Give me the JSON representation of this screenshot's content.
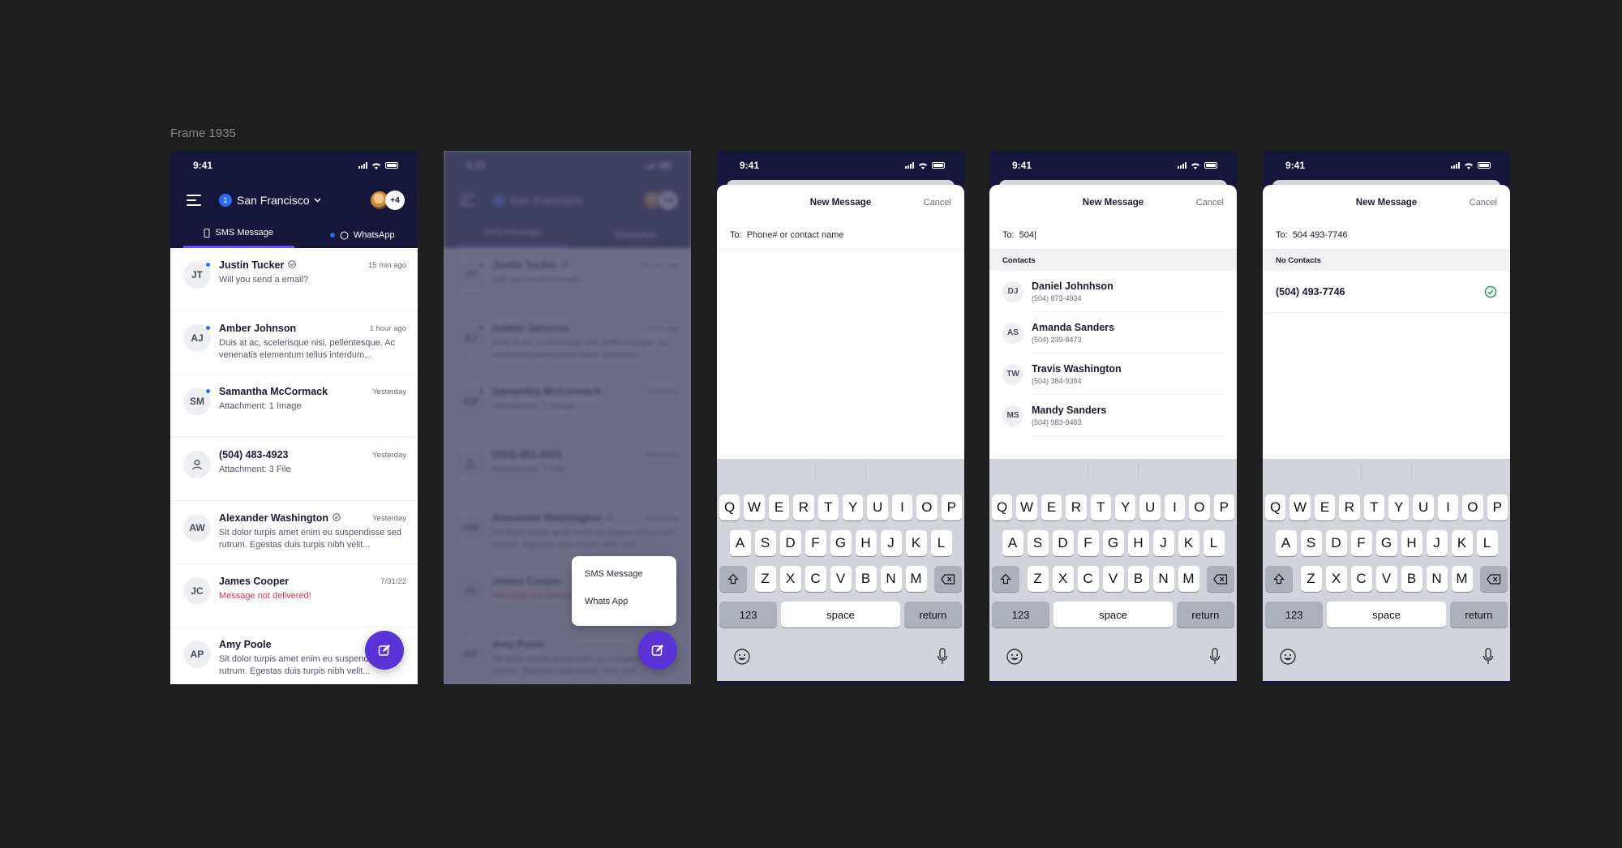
{
  "frame_title": "Frame 1935",
  "status_time": "9:41",
  "colors": {
    "header": "#16163a",
    "accent": "#5a33d6",
    "unread": "#2e6bf0",
    "error": "#e0314b"
  },
  "header": {
    "location_badge": "1",
    "location": "San Francisco",
    "more_count": "+4",
    "tabs": [
      "SMS Message",
      "WhatsApp"
    ]
  },
  "conversations": [
    {
      "initials": "JT",
      "name": "Justin Tucker",
      "verified": true,
      "time": "15 min ago",
      "msg": "Will you send a email?",
      "unread": true
    },
    {
      "initials": "AJ",
      "name": "Amber Johnson",
      "verified": false,
      "time": "1 hour ago",
      "msg": "Duis at ac, scelerisque nisi, pellentesque. Ac venenatis elementum tellus interdum...",
      "unread": true
    },
    {
      "initials": "SM",
      "name": "Samantha McCormack",
      "verified": false,
      "time": "Yesterday",
      "msg": "Attachment: 1 Image",
      "unread": true
    },
    {
      "initials": "",
      "name": "(504) 483-4923",
      "verified": false,
      "time": "Yesterday",
      "msg": "Attachment: 3 File",
      "unread": false,
      "icon": "person-icon"
    },
    {
      "initials": "AW",
      "name": "Alexander Washington",
      "verified": true,
      "time": "Yesterday",
      "msg": "Sit dolor turpis amet enim eu suspendisse sed rutrum. Egestas duis turpis nibh velit...",
      "unread": false
    },
    {
      "initials": "JC",
      "name": "James Cooper",
      "verified": false,
      "time": "7/31/22",
      "msg": "Message not delivered!",
      "unread": false,
      "error": true
    },
    {
      "initials": "AP",
      "name": "Amy Poole",
      "verified": false,
      "time": "",
      "msg": "Sit dolor turpis amet enim eu suspendisse sed rutrum. Egestas duis turpis nibh velit...",
      "unread": false
    }
  ],
  "popup": {
    "sms": "SMS Message",
    "whatsapp": "Whats App"
  },
  "new_message": {
    "title": "New Message",
    "cancel": "Cancel",
    "to_label": "To:",
    "placeholder": "Phone# or contact name",
    "typed_partial": "504|",
    "typed_full": "504 493-7746",
    "contacts_header": "Contacts",
    "no_contacts_header": "No Contacts",
    "contacts": [
      {
        "initials": "DJ",
        "name": "Daniel Johnhson",
        "phone": "(504) 873-4934"
      },
      {
        "initials": "AS",
        "name": "Amanda Sanders",
        "phone": "(504) 239-8473"
      },
      {
        "initials": "TW",
        "name": "Travis Washington",
        "phone": "(504) 384-9394"
      },
      {
        "initials": "MS",
        "name": "Mandy Sanders",
        "phone": "(504) 983-9493"
      }
    ],
    "result_number": "(504) 493-7746"
  },
  "keyboard": {
    "row1": [
      "Q",
      "W",
      "E",
      "R",
      "T",
      "Y",
      "U",
      "I",
      "O",
      "P"
    ],
    "row2": [
      "A",
      "S",
      "D",
      "F",
      "G",
      "H",
      "J",
      "K",
      "L"
    ],
    "row3": [
      "Z",
      "X",
      "C",
      "V",
      "B",
      "N",
      "M"
    ],
    "num": "123",
    "space": "space",
    "return": "return"
  }
}
